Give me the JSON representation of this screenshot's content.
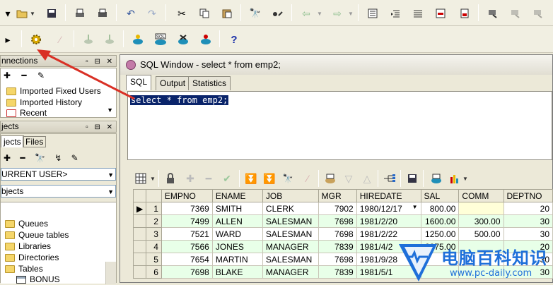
{
  "toolbar1": {
    "icons": [
      "new-dropdown-icon",
      "open-icon",
      "save-icon",
      "print-icon",
      "print-preview-icon",
      "undo-icon",
      "redo-icon",
      "cut-icon",
      "copy-icon",
      "paste-icon",
      "find-icon",
      "replace-icon",
      "back-icon",
      "forward-icon",
      "indent-icon",
      "unindent-icon",
      "comment-icon",
      "uncomment-icon",
      "tool-icon"
    ]
  },
  "toolbar2": {
    "icons": [
      "connect-icon",
      "gear-icon",
      "disabled-icon",
      "commit-icon",
      "rollback-icon",
      "db-execute-icon",
      "sql-icon",
      "db-stop-icon",
      "db-refresh-icon",
      "help-icon"
    ],
    "help_label": "?"
  },
  "connections": {
    "title": "nnections",
    "items": [
      "Imported Fixed Users",
      "Imported History",
      "Recent"
    ]
  },
  "objects": {
    "title": "jects",
    "tabs": [
      "jects",
      "Files"
    ],
    "user_combo": "URRENT USER>",
    "type_combo": "bjects",
    "items": [
      "Queues",
      "Queue tables",
      "Libraries",
      "Directories",
      "Tables",
      "BONUS"
    ]
  },
  "sql_window": {
    "title": "SQL Window - select * from emp2;",
    "tabs": [
      "SQL",
      "Output",
      "Statistics"
    ],
    "query": "select * from emp2;"
  },
  "grid": {
    "columns": [
      "EMPNO",
      "ENAME",
      "JOB",
      "MGR",
      "HIREDATE",
      "SAL",
      "COMM",
      "DEPTNO"
    ],
    "rows": [
      {
        "n": "1",
        "empno": "7369",
        "ename": "SMITH",
        "job": "CLERK",
        "mgr": "7902",
        "hiredate": "1980/12/17",
        "sal": "800.00",
        "comm": "",
        "deptno": "20"
      },
      {
        "n": "2",
        "empno": "7499",
        "ename": "ALLEN",
        "job": "SALESMAN",
        "mgr": "7698",
        "hiredate": "1981/2/20",
        "sal": "1600.00",
        "comm": "300.00",
        "deptno": "30"
      },
      {
        "n": "3",
        "empno": "7521",
        "ename": "WARD",
        "job": "SALESMAN",
        "mgr": "7698",
        "hiredate": "1981/2/22",
        "sal": "1250.00",
        "comm": "500.00",
        "deptno": "30"
      },
      {
        "n": "4",
        "empno": "7566",
        "ename": "JONES",
        "job": "MANAGER",
        "mgr": "7839",
        "hiredate": "1981/4/2",
        "sal": "2975.00",
        "comm": "",
        "deptno": "20"
      },
      {
        "n": "5",
        "empno": "7654",
        "ename": "MARTIN",
        "job": "SALESMAN",
        "mgr": "7698",
        "hiredate": "1981/9/28",
        "sal": "",
        "comm": "",
        "deptno": "30"
      },
      {
        "n": "6",
        "empno": "7698",
        "ename": "BLAKE",
        "job": "MANAGER",
        "mgr": "7839",
        "hiredate": "1981/5/1",
        "sal": "",
        "comm": "",
        "deptno": "30"
      }
    ]
  },
  "watermark": {
    "title": "电脑百科知识",
    "url": "www.pc-daily.com"
  },
  "colors": {
    "accent_red": "#D93025",
    "selection": "#0A246A",
    "row_alt": "#E8FFE8",
    "watermark_blue": "#1E6FD9"
  }
}
